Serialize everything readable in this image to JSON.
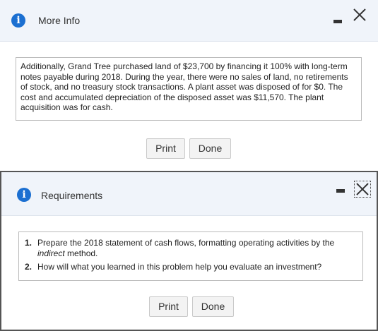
{
  "more_info_dialog": {
    "title": "More Info",
    "icon": "info-icon",
    "body": "Additionally, Grand Tree purchased land of $23,700 by financing it 100% with long-term notes payable during 2018. During the year, there were no sales of land, no retirements of stock, and no treasury stock transactions. A plant asset was disposed of for $0. The cost and accumulated depreciation of the disposed asset was $11,570. The plant acquisition was for cash.",
    "print_label": "Print",
    "done_label": "Done"
  },
  "requirements_dialog": {
    "title": "Requirements",
    "icon": "info-icon",
    "items": [
      {
        "number": "1.",
        "text_before": "Prepare the 2018 statement of cash flows, formatting operating activities by the ",
        "emphasis": "indirect",
        "text_after": " method."
      },
      {
        "number": "2.",
        "text": "How will what you learned in this problem help you evaluate an investment?"
      }
    ],
    "print_label": "Print",
    "done_label": "Done"
  },
  "colors": {
    "accent": "#1b6fd1",
    "titlebar_bg": "#f0f4fa"
  }
}
